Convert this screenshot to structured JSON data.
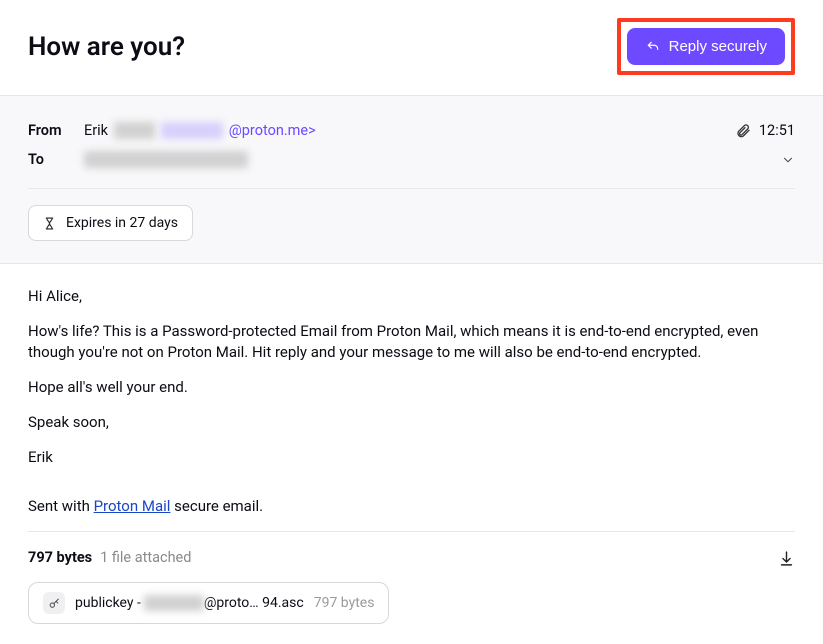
{
  "header": {
    "subject": "How are you?",
    "reply_label": "Reply securely"
  },
  "meta": {
    "from_label": "From",
    "from_name": "Erik",
    "from_hidden": "████",
    "from_hidden2": "██████",
    "from_domain": "@proton.me>",
    "time": "12:51",
    "to_label": "To",
    "to_hidden": "████████████████",
    "expires": "Expires in 27 days"
  },
  "body": {
    "p1": "Hi Alice,",
    "p2": "How's life? This is a Password-protected Email from Proton Mail, which means it is end-to-end encrypted, even though you're not on Proton Mail. Hit reply and your message to me will also be end-to-end encrypted.",
    "p3": "Hope all's well your end.",
    "p4": "Speak soon,",
    "p5": "Erik",
    "sent_with_prefix": "Sent with ",
    "proton_link": "Proton Mail",
    "sent_with_suffix": " secure email."
  },
  "attachments": {
    "total_size": "797 bytes",
    "count_text": "1 file attached",
    "file": {
      "prefix": "publickey - ",
      "hidden": "██████",
      "suffix": "@proto…  94.asc",
      "size": "797 bytes"
    }
  }
}
